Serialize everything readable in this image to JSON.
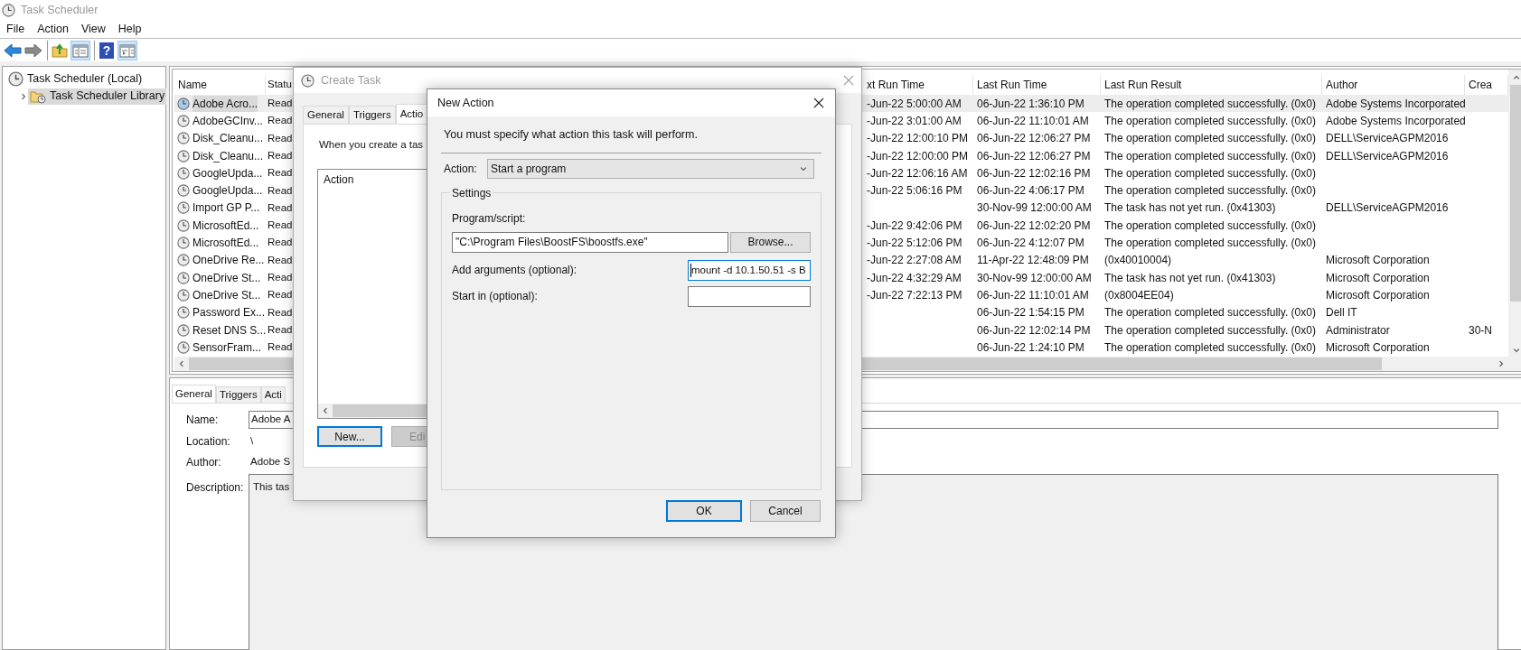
{
  "window": {
    "title": "Task Scheduler",
    "active": false
  },
  "menu": [
    "File",
    "Action",
    "View",
    "Help"
  ],
  "toolbar": [
    {
      "items": [
        {
          "kind": "back",
          "pressed": false
        },
        {
          "kind": "forward",
          "pressed": false
        }
      ]
    },
    {
      "items": [
        {
          "kind": "up-folder",
          "pressed": false
        },
        {
          "kind": "console-tree",
          "pressed": true
        }
      ]
    },
    {
      "items": [
        {
          "kind": "help",
          "glyph": "?",
          "pressed": false
        },
        {
          "kind": "action-pane",
          "pressed": true
        }
      ]
    }
  ],
  "tree": [
    {
      "label": "Task Scheduler (Local)",
      "kind": "root",
      "selected": false,
      "children": [
        {
          "label": "Task Scheduler Library",
          "kind": "folder",
          "selected": true,
          "expanded": false
        }
      ]
    }
  ],
  "table": {
    "columns": [
      "Name",
      "Statu",
      "xt Run Time",
      "Last Run Time",
      "Last Run Result",
      "Author",
      "Crea"
    ],
    "rows": [
      {
        "name": "Adobe Acro...",
        "status": "Read",
        "next_run_time": "-Jun-22 5:00:00 AM",
        "last_run_time": "06-Jun-22 1:36:10 PM",
        "last_run_result": "The operation completed successfully. (0x0)",
        "author": "Adobe Systems Incorporated",
        "selected": true
      },
      {
        "name": "AdobeGCInv...",
        "status": "Read",
        "next_run_time": "-Jun-22 3:01:00 AM",
        "last_run_time": "06-Jun-22 11:10:01 AM",
        "last_run_result": "The operation completed successfully. (0x0)",
        "author": "Adobe Systems Incorporated",
        "selected": false
      },
      {
        "name": "Disk_Cleanu...",
        "status": "Read",
        "next_run_time": "-Jun-22 12:00:10 PM",
        "last_run_time": "06-Jun-22 12:06:27 PM",
        "last_run_result": "The operation completed successfully. (0x0)",
        "author": "DELL\\ServiceAGPM2016",
        "selected": false
      },
      {
        "name": "Disk_Cleanu...",
        "status": "Read",
        "next_run_time": "-Jun-22 12:00:00 PM",
        "last_run_time": "06-Jun-22 12:06:27 PM",
        "last_run_result": "The operation completed successfully. (0x0)",
        "author": "DELL\\ServiceAGPM2016",
        "selected": false
      },
      {
        "name": "GoogleUpda...",
        "status": "Read",
        "next_run_time": "-Jun-22 12:06:16 AM",
        "last_run_time": "06-Jun-22 12:02:16 PM",
        "last_run_result": "The operation completed successfully. (0x0)",
        "selected": false
      },
      {
        "name": "GoogleUpda...",
        "status": "Read",
        "next_run_time": "-Jun-22 5:06:16 PM",
        "last_run_time": "06-Jun-22 4:06:17 PM",
        "last_run_result": "The operation completed successfully. (0x0)",
        "selected": false
      },
      {
        "name": "Import GP P...",
        "status": "Read",
        "last_run_time": "30-Nov-99 12:00:00 AM",
        "last_run_result": "The task has not yet run. (0x41303)",
        "author": "DELL\\ServiceAGPM2016",
        "selected": false
      },
      {
        "name": "MicrosoftEd...",
        "status": "Read",
        "next_run_time": "-Jun-22 9:42:06 PM",
        "last_run_time": "06-Jun-22 12:02:20 PM",
        "last_run_result": "The operation completed successfully. (0x0)",
        "selected": false
      },
      {
        "name": "MicrosoftEd...",
        "status": "Read",
        "next_run_time": "-Jun-22 5:12:06 PM",
        "last_run_time": "06-Jun-22 4:12:07 PM",
        "last_run_result": "The operation completed successfully. (0x0)",
        "selected": false
      },
      {
        "name": "OneDrive Re...",
        "status": "Read",
        "next_run_time": "-Jun-22 2:27:08 AM",
        "last_run_time": "11-Apr-22 12:48:09 PM",
        "last_run_result": "(0x40010004)",
        "author": "Microsoft Corporation",
        "selected": false
      },
      {
        "name": "OneDrive St...",
        "status": "Read",
        "next_run_time": "-Jun-22 4:32:29 AM",
        "last_run_time": "30-Nov-99 12:00:00 AM",
        "last_run_result": "The task has not yet run. (0x41303)",
        "author": "Microsoft Corporation",
        "selected": false
      },
      {
        "name": "OneDrive St...",
        "status": "Read",
        "next_run_time": "-Jun-22 7:22:13 PM",
        "last_run_time": "06-Jun-22 11:10:01 AM",
        "last_run_result": "(0x8004EE04)",
        "author": "Microsoft Corporation",
        "selected": false
      },
      {
        "name": "Password Ex...",
        "status": "Read",
        "last_run_time": "06-Jun-22 1:54:15 PM",
        "last_run_result": "The operation completed successfully. (0x0)",
        "author": "Dell IT",
        "selected": false
      },
      {
        "name": "Reset DNS S...",
        "status": "Read",
        "last_run_time": "06-Jun-22 12:02:14 PM",
        "last_run_result": "The operation completed successfully. (0x0)",
        "author": "Administrator",
        "column_7": "30-N",
        "selected": false
      },
      {
        "name": "SensorFram...",
        "status": "Read",
        "last_run_time": "06-Jun-22 1:24:10 PM",
        "last_run_result": "The operation completed successfully. (0x0)",
        "author": "Microsoft Corporation",
        "selected": false
      }
    ]
  },
  "details": {
    "tabs": [
      {
        "label": "General",
        "selected": true
      },
      {
        "label": "Triggers",
        "selected": false
      },
      {
        "label": "Acti",
        "selected": false
      }
    ],
    "fields": [
      {
        "label": "Name:",
        "value": "Adobe A",
        "kind": "field"
      },
      {
        "label": "Location:",
        "value": "\\",
        "kind": "text"
      },
      {
        "label": "Author:",
        "value": "Adobe S",
        "kind": "text"
      },
      {
        "label": "Description:",
        "value": "This tas",
        "kind": "box"
      }
    ]
  },
  "create_task": {
    "title": "Create Task",
    "active": false,
    "tabs": [
      {
        "label": "General",
        "selected": false
      },
      {
        "label": "Triggers",
        "selected": false
      },
      {
        "label": "Actio",
        "selected": true
      }
    ],
    "intro": "When you create a tas",
    "list_columns": [
      "Action"
    ],
    "buttons": [
      {
        "label": "New...",
        "focused": true,
        "disabled": false
      },
      {
        "label": "Edi",
        "focused": false,
        "disabled": true
      }
    ]
  },
  "new_action": {
    "title": "New Action",
    "prompt": "You must specify what action this task will perform.",
    "action": {
      "label": "Action:",
      "value": "Start a program"
    },
    "settings": {
      "title": "Settings",
      "program": {
        "label": "Program/script:",
        "value": "\"C:\\Program Files\\BoostFS\\boostfs.exe\"",
        "focused": false
      },
      "browse": "Browse...",
      "arguments": {
        "label": "Add arguments (optional):",
        "value": "mount -d 10.1.50.51 -s B",
        "focused": true
      },
      "start_in": {
        "label": "Start in (optional):",
        "focused": false
      }
    },
    "buttons": [
      {
        "label": "OK",
        "default": true
      },
      {
        "label": "Cancel",
        "default": false
      }
    ]
  }
}
